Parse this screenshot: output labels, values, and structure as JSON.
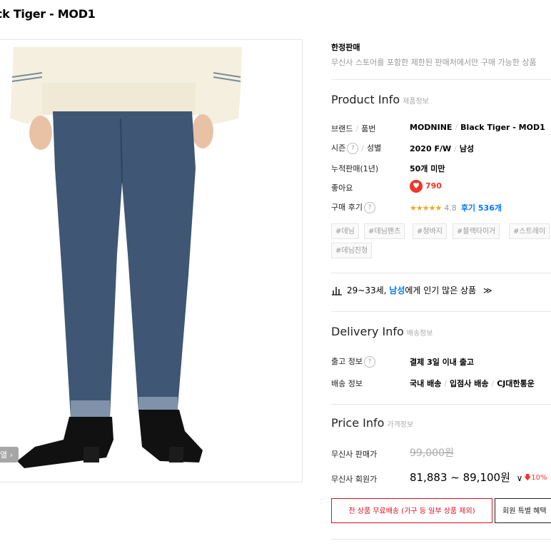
{
  "product": {
    "title": "ck Tiger - MOD1",
    "zoom_label": "열"
  },
  "limited": {
    "title": "한정판매",
    "desc": "무신사 스토어를 포함한 제한된 판매처에서만 구매 가능한 상품"
  },
  "product_info": {
    "title": "Product Info",
    "subtitle": "제품정보",
    "brand_label": "브랜드",
    "item_label": "품번",
    "brand": "MODNINE",
    "item_no": "Black Tiger - MOD1",
    "season_label": "시즌",
    "gender_label": "성별",
    "season": "2020 F/W",
    "gender": "남성",
    "sales_label": "누적판매(1년)",
    "sales": "50개 미만",
    "likes_label": "좋아요",
    "likes": "790",
    "review_label": "구매 후기",
    "stars": "★★★★★",
    "rating": "4.8",
    "review_count": "후기 536개",
    "help_mark": "?"
  },
  "tags": [
    "#데님",
    "#데님팬츠",
    "#청바지",
    "#블랙타이거",
    "#스트레이",
    "#데님진청"
  ],
  "popularity": {
    "prefix": "29~33세,",
    "gender": "남성",
    "suffix": "에게 인기 많은 상품"
  },
  "delivery_info": {
    "title": "Delivery Info",
    "subtitle": "배송정보",
    "ship_label": "출고 정보",
    "ship_value": "결제 3일 이내 출고",
    "delivery_label": "배송 정보",
    "domestic": "국내 배송",
    "vendor": "입점사 배송",
    "carrier": "CJ대한통운"
  },
  "price_info": {
    "title": "Price Info",
    "subtitle": "가격정보",
    "sale_label": "무신사 판매가",
    "sale_price": "99,000원",
    "member_label": "무신사 회원가",
    "member_price": "81,883 ~ 89,100원",
    "discount": "10%"
  },
  "buttons": {
    "free_shipping": "전 상품 무료배송 (가구 등 일부 상품 제외)",
    "member_benefit": "회원 특별 혜택"
  },
  "colors": {
    "accent_red": "#d8101f",
    "link_blue": "#0078ff",
    "star": "#f5a623"
  }
}
